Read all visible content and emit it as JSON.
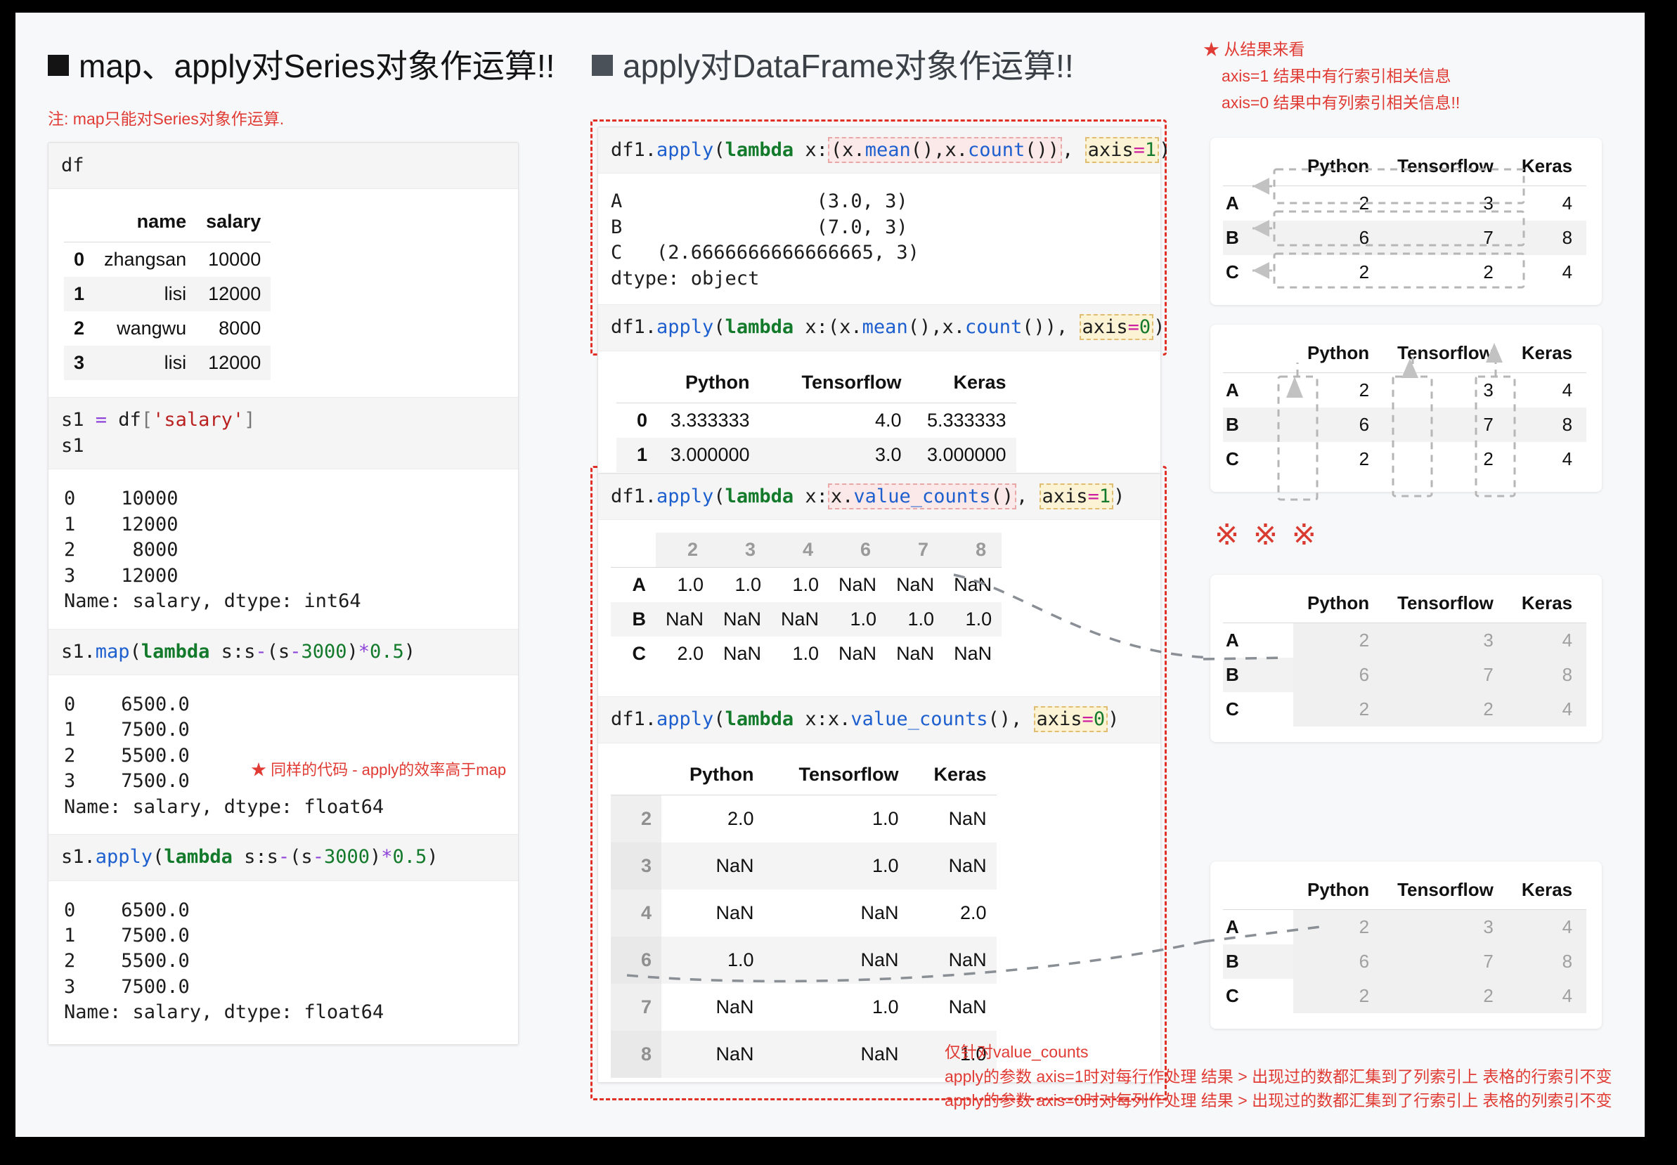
{
  "left": {
    "heading": "map、apply对Series对象作运算!!",
    "note": "注: map只能对Series对象作运算.",
    "cells": [
      {
        "code_df": "df"
      },
      {
        "code_s1": "s1 = df['salary']\ns1"
      }
    ],
    "df_table": {
      "columns": [
        "name",
        "salary"
      ],
      "index": [
        "0",
        "1",
        "2",
        "3"
      ],
      "rows": [
        [
          "zhangsan",
          "10000"
        ],
        [
          "lisi",
          "12000"
        ],
        [
          "wangwu",
          "8000"
        ],
        [
          "lisi",
          "12000"
        ]
      ]
    },
    "s1_output": "0    10000\n1    12000\n2     8000\n3    12000\nName: salary, dtype: int64",
    "map_code": "s1.map(lambda s:s-(s-3000)*0.5)",
    "map_output": "0    6500.0\n1    7500.0\n2    5500.0\n3    7500.0\nName: salary, dtype: float64",
    "map_output_lines": [
      "0    6500.0",
      "1    7500.0",
      "2    5500.0",
      "3    7500.0",
      "Name: salary, dtype: float64"
    ],
    "map_note": "★ 同样的代码 - apply的效率高于map",
    "apply_code": "s1.apply(lambda s:s-(s-3000)*0.5)",
    "apply_output": "0    6500.0\n1    7500.0\n2    5500.0\n3    7500.0\nName: salary, dtype: float64"
  },
  "middle": {
    "heading": "apply对DataFrame对象作运算!!",
    "block1": {
      "code_prefix": "df1.apply(",
      "code_kw": "lambda",
      "code_arg": " x:",
      "code_hl_func": "(x.mean(),x.count())",
      "code_comma": ", ",
      "code_hl_axis": "axis=1",
      "code_suffix": ")",
      "output": "A                 (3.0, 3)\nB                 (7.0, 3)\nC   (2.6666666666666665, 3)\ndtype: object",
      "output_lines": [
        "A                 (3.0, 3)",
        "B                 (7.0, 3)",
        "C   (2.6666666666666665, 3)",
        "dtype: object"
      ]
    },
    "block2": {
      "code_hl_axis": "axis=0",
      "table": {
        "columns": [
          "Python",
          "Tensorflow",
          "Keras"
        ],
        "index": [
          "0",
          "1"
        ],
        "rows": [
          [
            "3.333333",
            "4.0",
            "5.333333"
          ],
          [
            "3.000000",
            "3.0",
            "3.000000"
          ]
        ]
      }
    },
    "block3": {
      "code_hl_func": "x.value_counts()",
      "code_hl_axis": "axis=1",
      "table": {
        "columns": [
          "2",
          "3",
          "4",
          "6",
          "7",
          "8"
        ],
        "index": [
          "A",
          "B",
          "C"
        ],
        "rows": [
          [
            "1.0",
            "1.0",
            "1.0",
            "NaN",
            "NaN",
            "NaN"
          ],
          [
            "NaN",
            "NaN",
            "NaN",
            "1.0",
            "1.0",
            "1.0"
          ],
          [
            "2.0",
            "NaN",
            "1.0",
            "NaN",
            "NaN",
            "NaN"
          ]
        ]
      }
    },
    "block4": {
      "code_hl_axis": "axis=0",
      "table": {
        "columns": [
          "Python",
          "Tensorflow",
          "Keras"
        ],
        "index": [
          "2",
          "3",
          "4",
          "6",
          "7",
          "8"
        ],
        "rows": [
          [
            "2.0",
            "1.0",
            "NaN"
          ],
          [
            "NaN",
            "1.0",
            "NaN"
          ],
          [
            "NaN",
            "NaN",
            "2.0"
          ],
          [
            "1.0",
            "NaN",
            "NaN"
          ],
          [
            "NaN",
            "1.0",
            "NaN"
          ],
          [
            "NaN",
            "NaN",
            "1.0"
          ]
        ]
      }
    },
    "bottom_note": {
      "l1": "仅针对value_counts",
      "l2": "apply的参数 axis=1时对每行作处理  结果 > 出现过的数都汇集到了列索引上 表格的行索引不变",
      "l3": "apply的参数 axis=0时对每列作处理  结果 > 出现过的数都汇集到了行索引上 表格的列索引不变"
    }
  },
  "right": {
    "note": {
      "l1": "★ 从结果来看",
      "l2": "axis=1 结果中有行索引相关信息",
      "l3": "axis=0 结果中有列索引相关信息!!"
    },
    "kome": "※ ※ ※",
    "df1": {
      "columns": [
        "Python",
        "Tensorflow",
        "Keras"
      ],
      "index": [
        "A",
        "B",
        "C"
      ],
      "rows": [
        [
          "2",
          "3",
          "4"
        ],
        [
          "6",
          "7",
          "8"
        ],
        [
          "2",
          "2",
          "4"
        ]
      ]
    }
  },
  "colors": {
    "accent_red": "#e03b34",
    "dash_red": "#e03027",
    "code_blue": "#1d5fce",
    "code_green": "#137a2b",
    "code_purple": "#8e44d8",
    "code_string": "#ba2121",
    "hl_pink": "#fbe9e9",
    "hl_yellow": "#fcf3d4",
    "page_bg": "#f7f8fa"
  }
}
